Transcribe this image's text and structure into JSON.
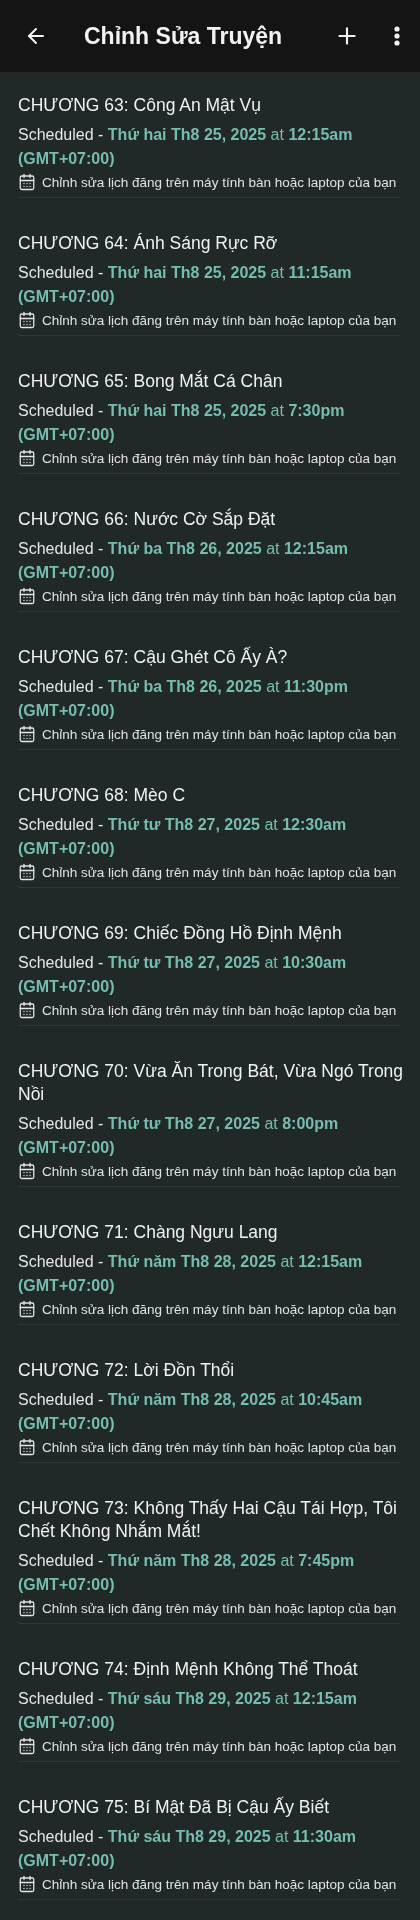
{
  "app_bar": {
    "title": "Chỉnh Sửa Truyện"
  },
  "chapters": [
    {
      "title": "CHƯƠNG 63: Công An Mật Vụ",
      "status": "Scheduled -",
      "when": "**Thứ hai Th8 25, 2025** at **12:15am (GMT+07:00)**",
      "note": "Chỉnh sửa lịch đăng trên máy tính bàn hoặc laptop của bạn"
    },
    {
      "title": "CHƯƠNG 64: Ánh Sáng Rực Rỡ",
      "status": "Scheduled -",
      "when": "**Thứ hai Th8 25, 2025** at **11:15am (GMT+07:00)**",
      "note": "Chỉnh sửa lịch đăng trên máy tính bàn hoặc laptop của bạn"
    },
    {
      "title": "CHƯƠNG 65: Bong Mắt Cá Chân",
      "status": "Scheduled -",
      "when": "**Thứ hai Th8 25, 2025** at **7:30pm (GMT+07:00)**",
      "note": "Chỉnh sửa lịch đăng trên máy tính bàn hoặc laptop của bạn"
    },
    {
      "title": "CHƯƠNG 66: Nước Cờ Sắp Đặt",
      "status": "Scheduled -",
      "when": "**Thứ ba Th8 26, 2025** at **12:15am (GMT+07:00)**",
      "note": "Chỉnh sửa lịch đăng trên máy tính bàn hoặc laptop của bạn"
    },
    {
      "title": "CHƯƠNG 67: Cậu Ghét Cô Ấy À?",
      "status": "Scheduled -",
      "when": "**Thứ ba Th8 26, 2025** at **11:30pm (GMT+07:00)**",
      "note": "Chỉnh sửa lịch đăng trên máy tính bàn hoặc laptop của bạn"
    },
    {
      "title": "CHƯƠNG 68: Mèo C",
      "status": "Scheduled -",
      "when": "**Thứ tư Th8 27, 2025** at **12:30am (GMT+07:00)**",
      "note": "Chỉnh sửa lịch đăng trên máy tính bàn hoặc laptop của bạn"
    },
    {
      "title": "CHƯƠNG 69: Chiếc Đồng Hồ Định Mệnh",
      "status": "Scheduled -",
      "when": "**Thứ tư Th8 27, 2025** at **10:30am (GMT+07:00)**",
      "note": "Chỉnh sửa lịch đăng trên máy tính bàn hoặc laptop của bạn"
    },
    {
      "title": "CHƯƠNG 70: Vừa Ăn Trong Bát, Vừa Ngó Trong Nồi",
      "status": "Scheduled -",
      "when": "**Thứ tư Th8 27, 2025** at **8:00pm (GMT+07:00)**",
      "note": "Chỉnh sửa lịch đăng trên máy tính bàn hoặc laptop của bạn"
    },
    {
      "title": "CHƯƠNG 71: Chàng Ngưu Lang",
      "status": "Scheduled -",
      "when": "**Thứ năm Th8 28, 2025** at **12:15am (GMT+07:00)**",
      "note": "Chỉnh sửa lịch đăng trên máy tính bàn hoặc laptop của bạn"
    },
    {
      "title": "CHƯƠNG 72: Lời Đồn Thổi",
      "status": "Scheduled -",
      "when": "**Thứ năm Th8 28, 2025** at **10:45am (GMT+07:00)**",
      "note": "Chỉnh sửa lịch đăng trên máy tính bàn hoặc laptop của bạn"
    },
    {
      "title": "CHƯƠNG 73: Không Thấy Hai Cậu Tái Hợp, Tôi Chết Không Nhắm Mắt!",
      "status": "Scheduled -",
      "when": "**Thứ năm Th8 28, 2025** at **7:45pm (GMT+07:00)**",
      "note": "Chỉnh sửa lịch đăng trên máy tính bàn hoặc laptop của bạn"
    },
    {
      "title": "CHƯƠNG 74: Định Mệnh Không Thể Thoát",
      "status": "Scheduled -",
      "when": "**Thứ sáu Th8 29, 2025** at **12:15am (GMT+07:00)**",
      "note": "Chỉnh sửa lịch đăng trên máy tính bàn hoặc laptop của bạn"
    },
    {
      "title": "CHƯƠNG 75: Bí Mật Đã Bị Cậu Ấy Biết",
      "status": "Scheduled -",
      "when": "**Thứ sáu Th8 29, 2025** at **11:30am (GMT+07:00)**",
      "note": "Chỉnh sửa lịch đăng trên máy tính bàn hoặc laptop của bạn"
    }
  ]
}
